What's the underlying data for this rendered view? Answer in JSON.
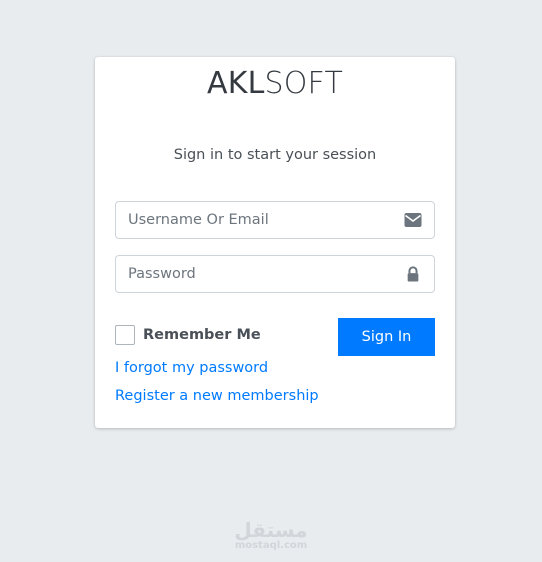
{
  "brand": {
    "part1": "AKL",
    "part2": "SOFT"
  },
  "subtitle": "Sign in to start your session",
  "form": {
    "username_placeholder": "Username Or Email",
    "username_value": "",
    "username_icon": "envelope-icon",
    "password_placeholder": "Password",
    "password_value": "",
    "password_icon": "lock-icon",
    "remember_label": "Remember Me",
    "remember_checked": false,
    "signin_label": "Sign In"
  },
  "links": {
    "forgot": "I forgot my password",
    "register": "Register a new membership"
  },
  "watermark": {
    "arabic": "مستقل",
    "latin": "mostaql.com"
  },
  "colors": {
    "background": "#e9ecef",
    "primary": "#007bff",
    "text": "#495057"
  }
}
